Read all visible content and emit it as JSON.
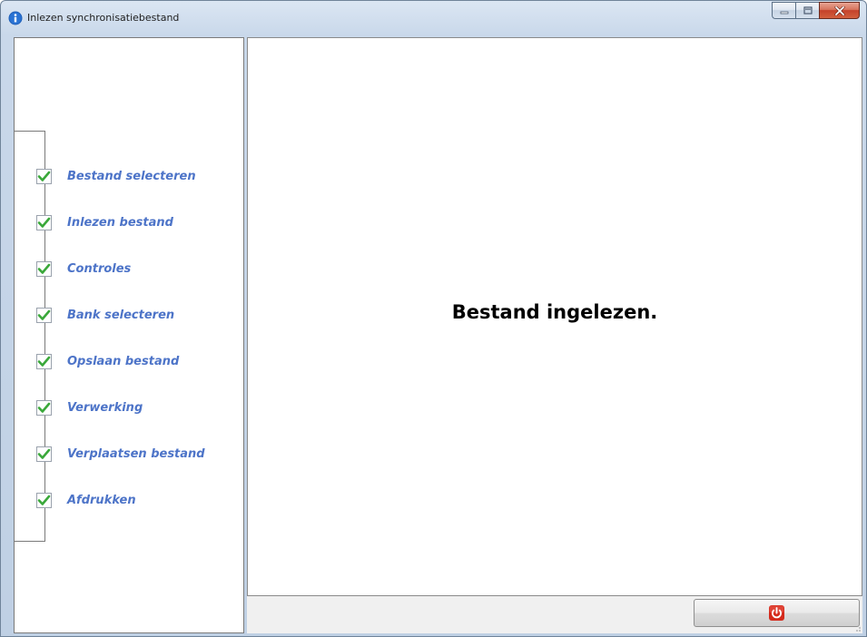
{
  "window": {
    "title": "Inlezen synchronisatiebestand",
    "title_icon": "info-icon"
  },
  "window_controls": {
    "minimize_icon": "minimize-icon",
    "maximize_icon": "maximize-icon",
    "close_icon": "close-icon"
  },
  "steps": [
    {
      "label": "Bestand selecteren",
      "status_icon": "check-icon",
      "completed": true
    },
    {
      "label": "Inlezen bestand",
      "status_icon": "check-icon",
      "completed": true
    },
    {
      "label": "Controles",
      "status_icon": "check-icon",
      "completed": true
    },
    {
      "label": "Bank selecteren",
      "status_icon": "check-icon",
      "completed": true
    },
    {
      "label": "Opslaan bestand",
      "status_icon": "check-icon",
      "completed": true
    },
    {
      "label": "Verwerking",
      "status_icon": "check-icon",
      "completed": true
    },
    {
      "label": "Verplaatsen bestand",
      "status_icon": "check-icon",
      "completed": true
    },
    {
      "label": "Afdrukken",
      "status_icon": "check-icon",
      "completed": true
    }
  ],
  "main": {
    "message": "Bestand ingelezen."
  },
  "footer": {
    "power_button_icon": "power-icon"
  },
  "colors": {
    "step_label": "#4d74c8",
    "check_green": "#3aa83a",
    "power_red": "#d42a1c"
  }
}
